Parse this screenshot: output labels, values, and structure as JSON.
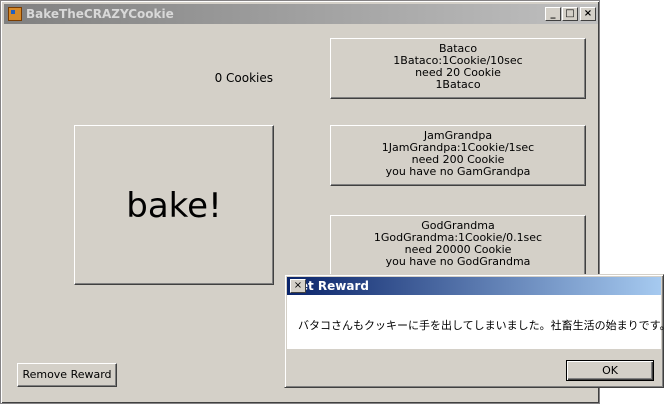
{
  "window": {
    "title": "BakeTheCRAZYCookie",
    "controls": {
      "minimize": "_",
      "maximize": "□",
      "close": "×"
    }
  },
  "counter": {
    "text": "0 Cookies"
  },
  "bake_button": {
    "label": "bake!"
  },
  "shop": [
    {
      "lines": [
        "Bataco",
        "1Bataco:1Cookie/10sec",
        "need 20 Cookie",
        "1Bataco"
      ]
    },
    {
      "lines": [
        "JamGrandpa",
        "1JamGrandpa:1Cookie/1sec",
        "need 200 Cookie",
        "you have no GamGrandpa"
      ]
    },
    {
      "lines": [
        "GodGrandma",
        "1GodGrandma:1Cookie/0.1sec",
        "need 20000 Cookie",
        "you have no GodGrandma"
      ]
    }
  ],
  "remove_reward_button": {
    "label": "Remove Reward"
  },
  "dialog": {
    "title": "Get Reward",
    "close": "×",
    "message": "バタコさんもクッキーに手を出してしまいました。社畜生活の始まりです。",
    "ok_label": "OK"
  },
  "colors": {
    "window_bg": "#d4d0c8",
    "inactive_title": "#808080",
    "active_title": "#0a246a"
  }
}
